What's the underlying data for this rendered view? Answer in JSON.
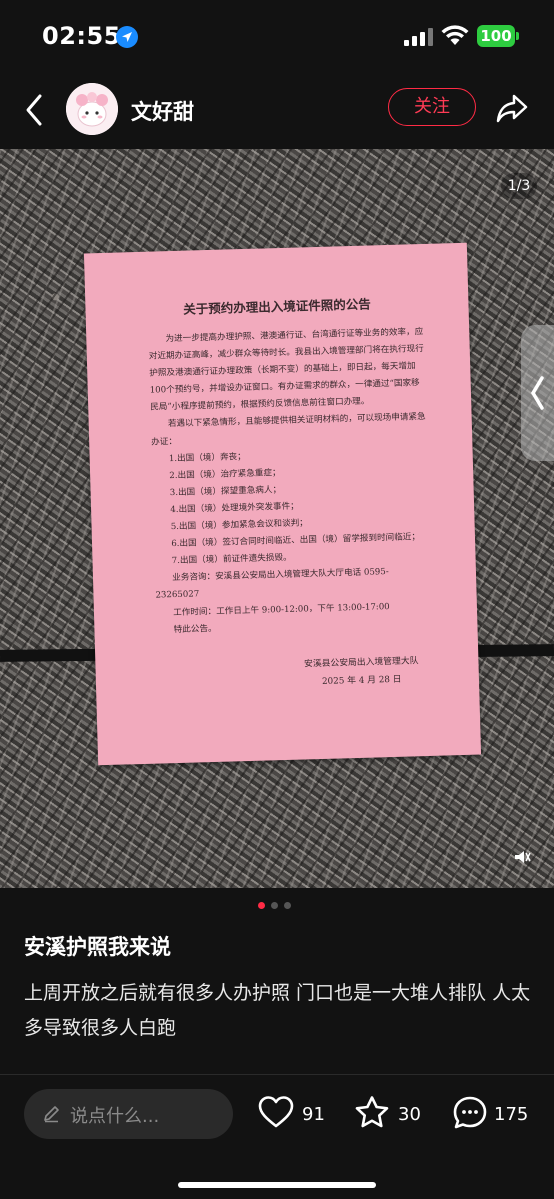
{
  "status": {
    "time": "02:55",
    "battery": "100"
  },
  "header": {
    "username": "文好甜",
    "follow_label": "关注"
  },
  "photo": {
    "counter": "1/3",
    "notice": {
      "title": "关于预约办理出入境证件照的公告",
      "paragraphs": [
        "为进一步提高办理护照、港澳通行证、台湾通行证等业务的效率，应对近期办证高峰，减少群众等待时长。我县出入境管理部门将在执行现行护照及港澳通行证办理政策（长期不变）的基础上，即日起，每天增加100个预约号，并增设办证窗口。有办证需求的群众，一律通过“国家移民局”小程序提前预约，根据预约反馈信息前往窗口办理。",
        "若遇以下紧急情形，且能够提供相关证明材料的，可以现场申请紧急办证："
      ],
      "items": [
        "1.出国（境）奔丧；",
        "2.出国（境）治疗紧急重症；",
        "3.出国（境）探望重急病人；",
        "4.出国（境）处理境外突发事件；",
        "5.出国（境）参加紧急会议和谈判；",
        "6.出国（境）签订合同时间临近、出国（境）留学报到时间临近；",
        "7.出国（境）前证件遗失损毁。"
      ],
      "consult": "业务咨询：安溪县公安局出入境管理大队大厅电话 0595-23265027",
      "hours": "工作时间：工作日上午 9:00-12:00，下午 13:00-17:00",
      "closing": "特此公告。",
      "signer": "安溪县公安局出入境管理大队",
      "date": "2025 年 4 月 28 日"
    }
  },
  "post": {
    "title": "安溪护照我来说",
    "description": "上周开放之后就有很多人办护照 门口也是一大堆人排队 人太多导致很多人白跑"
  },
  "bottom": {
    "comment_placeholder": "说点什么...",
    "likes": "91",
    "favorites": "30",
    "comments": "175"
  },
  "colors": {
    "accent": "#ff2b45",
    "paper": "#f2aabd",
    "background": "#121212"
  },
  "icons": [
    "location-arrow-icon",
    "signal-icon",
    "wifi-icon",
    "battery-icon",
    "back-arrow-icon",
    "share-icon",
    "chevron-left-icon",
    "sound-icon",
    "pen-icon",
    "heart-icon",
    "star-icon",
    "comment-bubble-icon"
  ]
}
